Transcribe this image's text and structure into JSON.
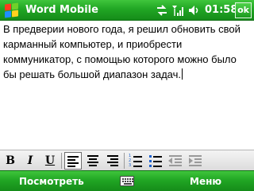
{
  "titlebar": {
    "app_title": "Word Mobile",
    "clock": "01:58",
    "ok_label": "ok",
    "tray_icons": [
      "connectivity-icon",
      "signal-strength-icon",
      "volume-icon"
    ]
  },
  "document": {
    "paragraph": "В предверии нового года, я решил обновить свой карманный компьютер, и приобрести коммуникатор, с помощью которого можно было бы решать большой диапазон задач."
  },
  "toolbar": {
    "bold_label": "B",
    "italic_label": "I",
    "underline_label": "U",
    "buttons": [
      "bold",
      "italic",
      "underline",
      "align-left",
      "align-center",
      "align-right",
      "numbered-list",
      "bulleted-list",
      "decrease-indent",
      "increase-indent"
    ],
    "active_alignment": "align-left"
  },
  "softkeys": {
    "left": "Посмотреть",
    "right": "Меню",
    "center_icon": "keyboard-icon"
  },
  "colors": {
    "bar_green": "#21a624",
    "toolbar_grey": "#e6e6e6",
    "accent_blue": "#1b5fcf"
  }
}
